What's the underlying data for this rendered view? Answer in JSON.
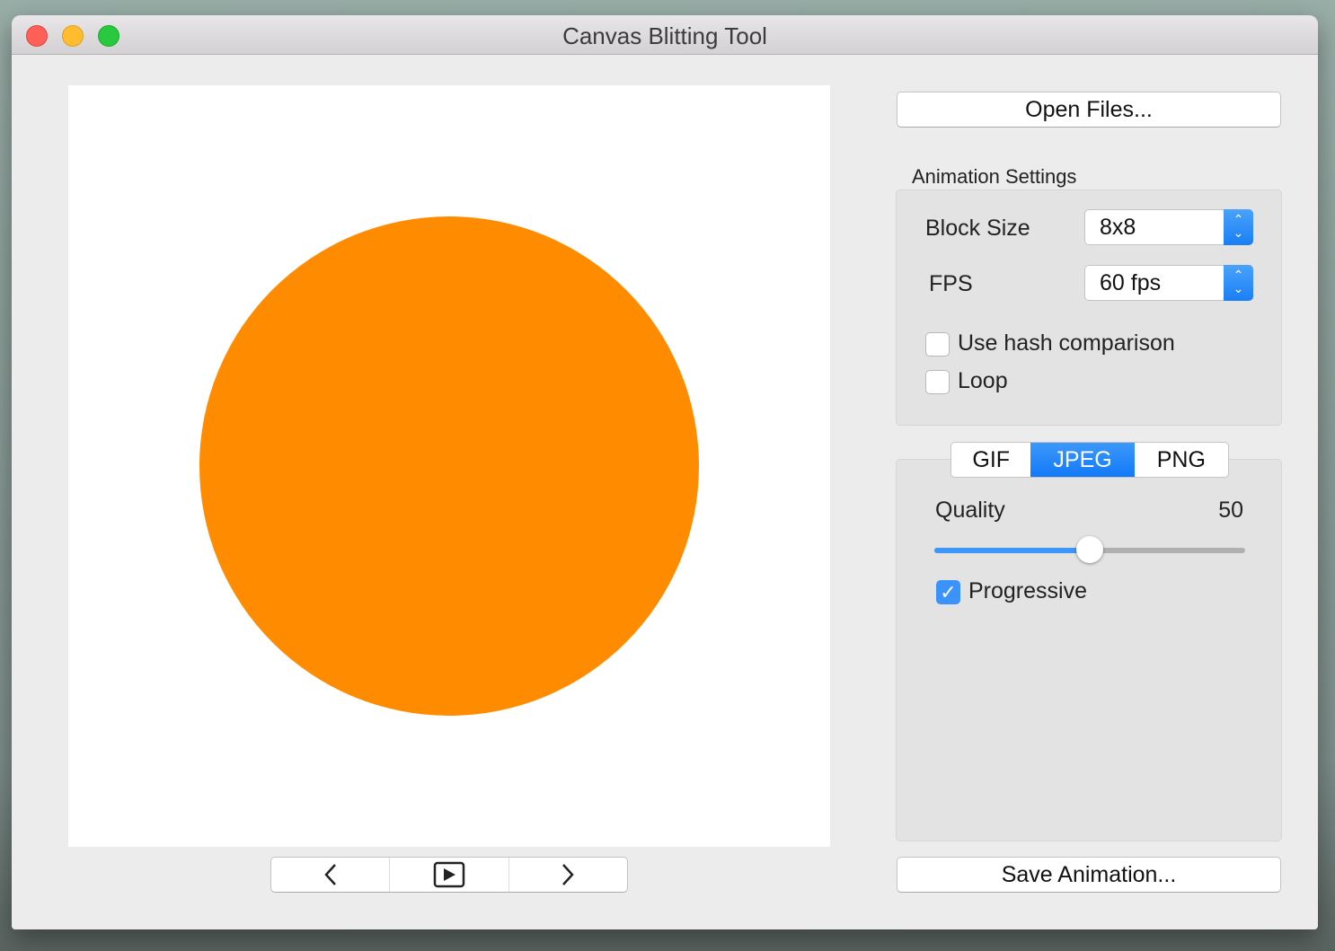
{
  "window": {
    "title": "Canvas Blitting Tool",
    "traffic_lights": {
      "close": "#fe5f57",
      "minimize": "#febc2e",
      "zoom": "#28c840"
    }
  },
  "canvas": {
    "shape": "circle",
    "color": "#ff8c00"
  },
  "playback": {
    "prev_icon": "chevron-left-icon",
    "play_icon": "play-icon",
    "next_icon": "chevron-right-icon"
  },
  "open_files_label": "Open Files...",
  "animation_settings": {
    "title": "Animation Settings",
    "block_size_label": "Block Size",
    "block_size_value": "8x8",
    "fps_label": "FPS",
    "fps_value": "60 fps",
    "hash_label": "Use hash comparison",
    "hash_checked": false,
    "loop_label": "Loop",
    "loop_checked": false
  },
  "format": {
    "tabs": [
      "GIF",
      "JPEG",
      "PNG"
    ],
    "selected": "JPEG",
    "quality_label": "Quality",
    "quality_value": "50",
    "quality_fraction": 0.5,
    "progressive_label": "Progressive",
    "progressive_checked": true,
    "accent": "#1a7ff5"
  },
  "save_label": "Save Animation..."
}
